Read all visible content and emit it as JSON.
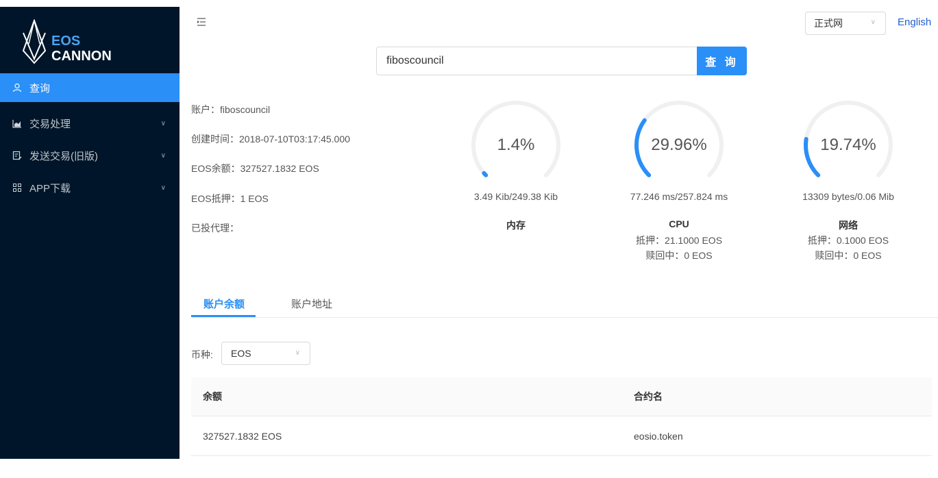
{
  "brand": {
    "line1": "EOS",
    "line2": "CANNON"
  },
  "sidebar": {
    "items": [
      {
        "label": "查询",
        "icon": "user-icon",
        "active": true
      },
      {
        "label": "交易处理",
        "icon": "area-chart-icon",
        "active": false
      },
      {
        "label": "发送交易(旧版)",
        "icon": "form-icon",
        "active": false
      },
      {
        "label": "APP下载",
        "icon": "app-grid-icon",
        "active": false
      }
    ]
  },
  "header": {
    "network_select": "正式网",
    "language_link": "English"
  },
  "search": {
    "value": "fiboscouncil",
    "button_label": "查 询"
  },
  "account": {
    "name_label": "账户：",
    "name": "fiboscouncil",
    "created_label": "创建时间：",
    "created": "2018-07-10T03:17:45.000",
    "balance_label": "EOS余额：",
    "balance": "327527.1832 EOS",
    "staked_label": "EOS抵押：",
    "staked": "1 EOS",
    "voted_label": "已投代理："
  },
  "resources": [
    {
      "title": "内存",
      "percent_text": "1.4%",
      "percent": 1.4,
      "usage": "3.49 Kib/249.38 Kib",
      "stake_line": "",
      "refund_line": ""
    },
    {
      "title": "CPU",
      "percent_text": "29.96%",
      "percent": 29.96,
      "usage": "77.246 ms/257.824 ms",
      "stake_line": "抵押：21.1000 EOS",
      "refund_line": "赎回中：0 EOS"
    },
    {
      "title": "网络",
      "percent_text": "19.74%",
      "percent": 19.74,
      "usage": "13309 bytes/0.06 Mib",
      "stake_line": "抵押：0.1000 EOS",
      "refund_line": "赎回中：0 EOS"
    }
  ],
  "tabs": [
    {
      "label": "账户余额",
      "active": true
    },
    {
      "label": "账户地址",
      "active": false
    }
  ],
  "currency_filter": {
    "label": "币种:",
    "value": "EOS"
  },
  "table": {
    "headers": [
      "余额",
      "合约名"
    ],
    "rows": [
      [
        "327527.1832 EOS",
        "eosio.token"
      ]
    ]
  },
  "colors": {
    "sidebar_bg": "#001529",
    "accent": "#2a8ff7",
    "gauge_track": "#f0f0f0"
  }
}
